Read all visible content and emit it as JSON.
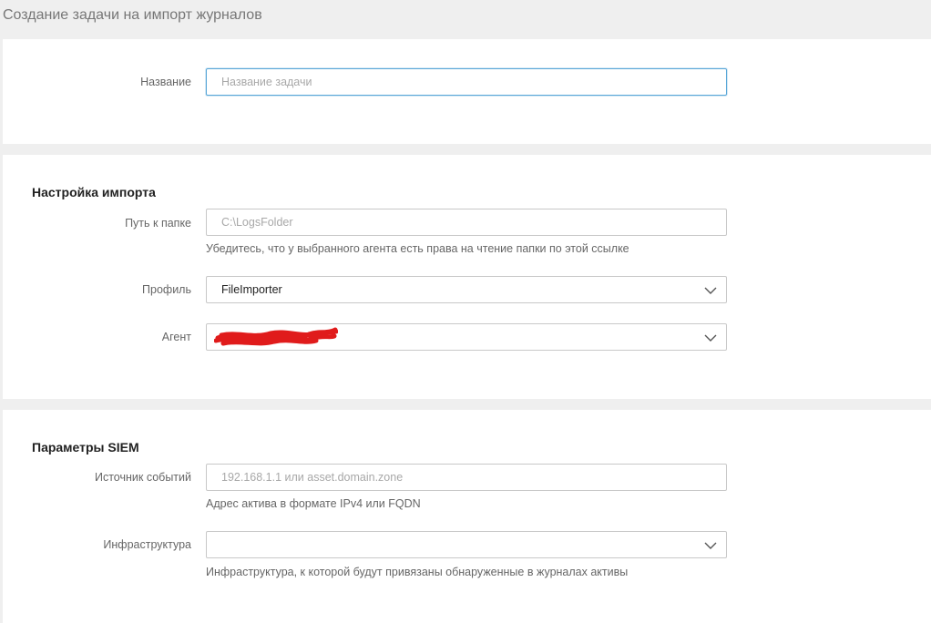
{
  "page": {
    "title": "Создание задачи на импорт журналов"
  },
  "task": {
    "name_label": "Название",
    "name_placeholder": "Название задачи",
    "name_value": ""
  },
  "import_settings": {
    "title": "Настройка импорта",
    "folder_label": "Путь к папке",
    "folder_placeholder": "C:\\LogsFolder",
    "folder_value": "",
    "folder_hint": "Убедитесь, что у выбранного агента есть права на чтение папки по этой ссылке",
    "profile_label": "Профиль",
    "profile_value": "FileImporter",
    "agent_label": "Агент",
    "agent_value_redacted": true
  },
  "siem_params": {
    "title": "Параметры SIEM",
    "source_label": "Источник событий",
    "source_placeholder": "192.168.1.1 или asset.domain.zone",
    "source_value": "",
    "source_hint": "Адрес актива в формате IPv4 или FQDN",
    "infra_label": "Инфраструктура",
    "infra_value": "",
    "infra_hint": "Инфраструктура, к которой будут привязаны обнаруженные в журналах активы"
  },
  "colors": {
    "background": "#efefef",
    "card": "#ffffff",
    "border": "#c8c8c8",
    "focus_border": "#5aa7d8",
    "label_text": "#666666",
    "title_text": "#777777",
    "heading_text": "#222222",
    "redaction": "#e01b1b"
  },
  "icons": {
    "dropdown": "chevron-down-icon"
  }
}
